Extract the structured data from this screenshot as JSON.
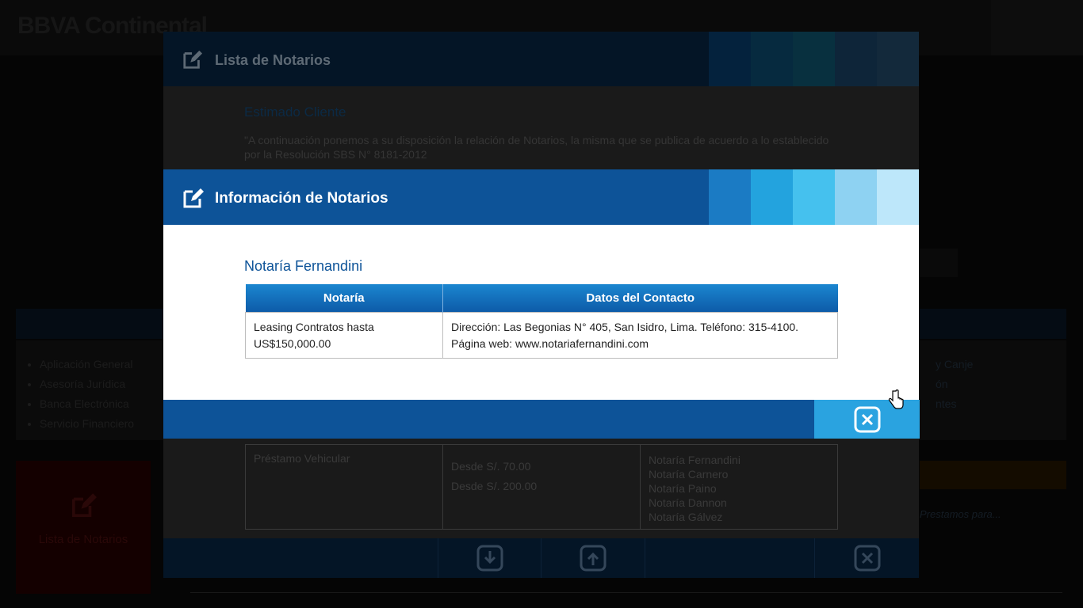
{
  "background": {
    "logo": "BBVA Continental",
    "list_items": [
      "Aplicación General",
      "Asesoría Jurídica",
      "Banca Electrónica",
      "Servicio Financiero"
    ],
    "list_right": [
      "y Canje",
      "ón",
      "ntes"
    ],
    "tile_label": "Lista de Notarios",
    "right_note": "Prestamos para..."
  },
  "modal_list": {
    "title": "Lista de Notarios",
    "heading": "Estimado Cliente",
    "intro": "\"A continuación ponemos a su disposición la relación de Notarios, la misma que se publica de acuerdo a lo establecido por la Resolución SBS N° 8181-2012",
    "table_row": {
      "product": "Préstamo Vehicular",
      "fees": [
        "Desde S/. 70.00",
        "Desde S/. 200.00"
      ],
      "notaries": [
        "Notaría Fernandini",
        "Notaría Carnero",
        "Notaría Paino",
        "Notaría Dannon",
        "Notaría Gálvez"
      ]
    },
    "footer_icons": [
      "download-icon",
      "upload-icon",
      "close-icon"
    ]
  },
  "modal_info": {
    "title": "Información de Notarios",
    "subtitle": "Notaría Fernandini",
    "columns": [
      "Notaría",
      "Datos del Contacto"
    ],
    "rows": [
      {
        "notaria": "Leasing Contratos hasta US$150,000.00",
        "contacto": "Dirección: Las Begonias N° 405, San Isidro, Lima. Teléfono: 315-4100. Página web: www.notariafernandini.com"
      }
    ],
    "close_icon": "close-icon"
  },
  "colors": {
    "primary": "#0d5398",
    "accent": "#2aa3e0",
    "stripes": [
      "#1b7bc4",
      "#23a3de",
      "#45c1ee",
      "#8ed2f2",
      "#bde7fa"
    ]
  }
}
